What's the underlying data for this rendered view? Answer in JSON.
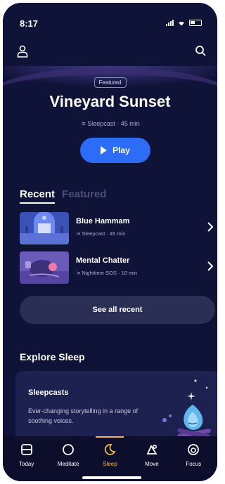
{
  "status_bar": {
    "time": "8:17"
  },
  "header": {
    "user_icon": "person-icon",
    "search_icon": "search-icon"
  },
  "hero": {
    "badge": "Featured",
    "title": "Vineyard Sunset",
    "meta": "Sleepcast · 45 min",
    "play_label": "Play"
  },
  "tabs": {
    "recent": "Recent",
    "featured": "Featured"
  },
  "recent": [
    {
      "title": "Blue Hammam",
      "sub": "Sleepcast · 45 min"
    },
    {
      "title": "Mental Chatter",
      "sub": "Nighttime SOS · 10 min"
    }
  ],
  "see_all": "See all recent",
  "explore": {
    "heading": "Explore Sleep",
    "card_title": "Sleepcasts",
    "card_desc": "Ever-changing storytelling in a range of soothing voices."
  },
  "tabbar": [
    {
      "label": "Today",
      "icon": "calendar-icon"
    },
    {
      "label": "Meditate",
      "icon": "circle-icon"
    },
    {
      "label": "Sleep",
      "icon": "moon-icon"
    },
    {
      "label": "Move",
      "icon": "move-icon"
    },
    {
      "label": "Focus",
      "icon": "focus-icon"
    }
  ],
  "colors": {
    "background": "#101338",
    "accent": "#2d6cf6",
    "active_tab": "#f2b849"
  }
}
